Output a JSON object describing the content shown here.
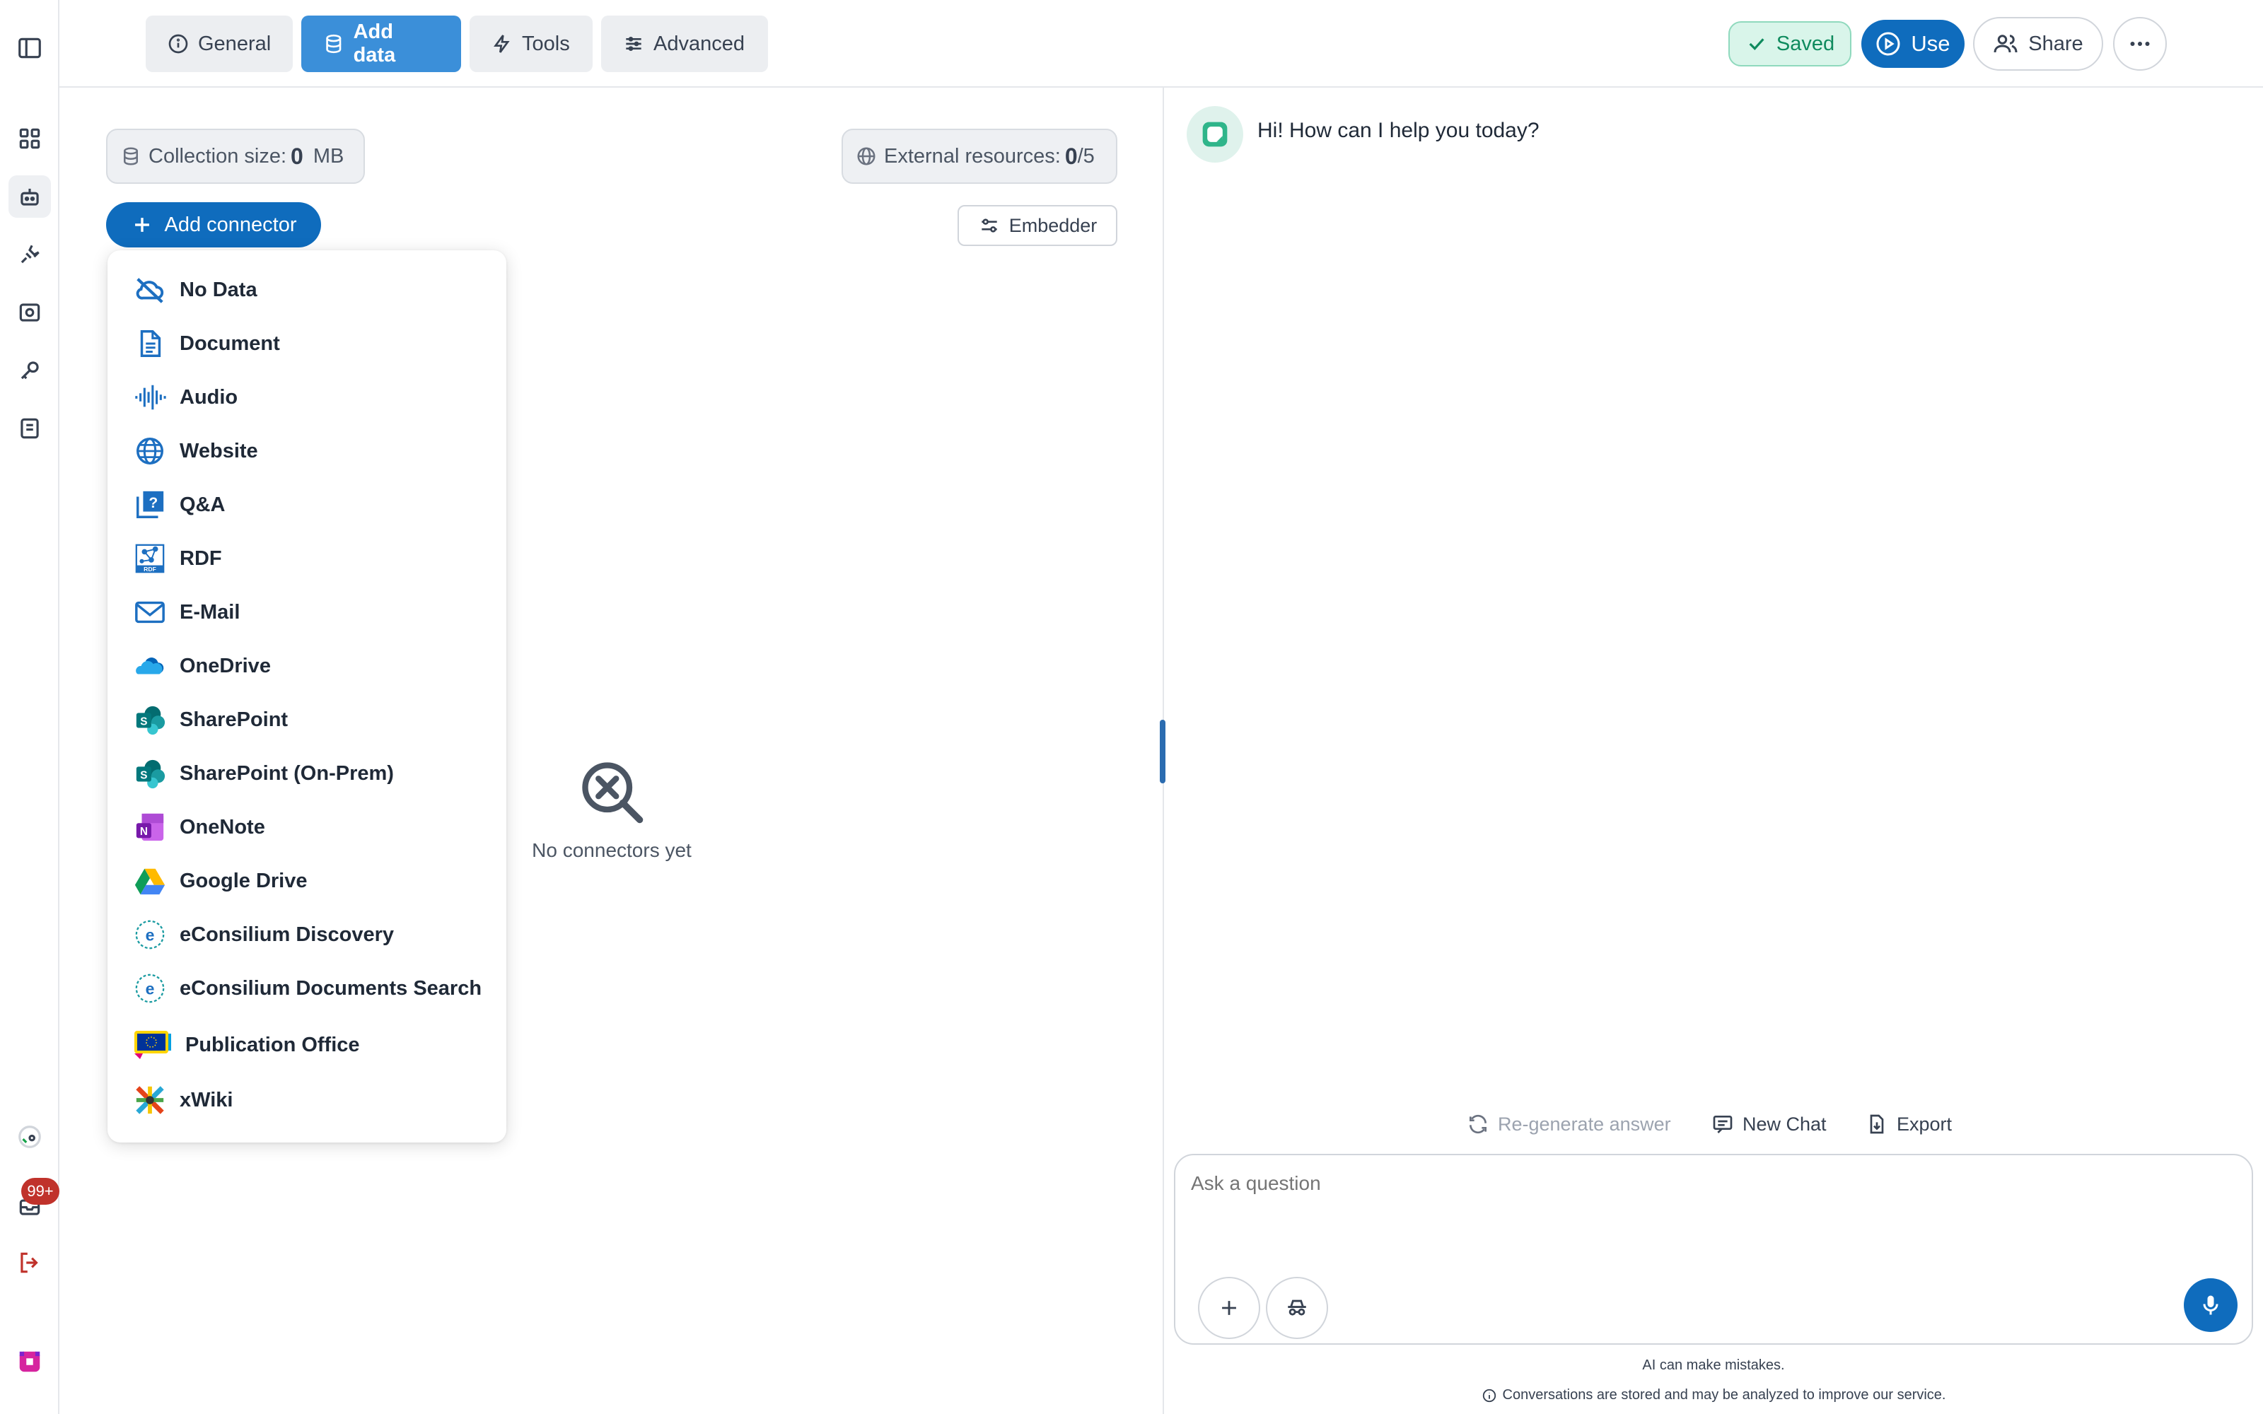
{
  "tabs": [
    {
      "label": "General",
      "icon": "info-icon",
      "active": false
    },
    {
      "label": "Add data",
      "icon": "database-icon",
      "active": true
    },
    {
      "label": "Tools",
      "icon": "lightning-icon",
      "active": false
    },
    {
      "label": "Advanced",
      "icon": "sliders-icon",
      "active": false
    }
  ],
  "header": {
    "saved_label": "Saved",
    "use_label": "Use",
    "share_label": "Share"
  },
  "rail": {
    "notification_count": "99+"
  },
  "left_panel": {
    "collection_label": "Collection size:",
    "collection_value": "0",
    "collection_unit": "MB",
    "external_label": "External resources:",
    "external_value": "0",
    "external_total": "/5",
    "add_connector_label": "Add connector",
    "embedder_label": "Embedder",
    "empty_text": "No connectors yet"
  },
  "connectors": [
    {
      "label": "No Data",
      "icon": "no-data-icon"
    },
    {
      "label": "Document",
      "icon": "document-icon"
    },
    {
      "label": "Audio",
      "icon": "audio-icon"
    },
    {
      "label": "Website",
      "icon": "globe-icon"
    },
    {
      "label": "Q&A",
      "icon": "qa-icon"
    },
    {
      "label": "RDF",
      "icon": "rdf-icon"
    },
    {
      "label": "E-Mail",
      "icon": "mail-icon"
    },
    {
      "label": "OneDrive",
      "icon": "onedrive-icon"
    },
    {
      "label": "SharePoint",
      "icon": "sharepoint-icon"
    },
    {
      "label": "SharePoint (On-Prem)",
      "icon": "sharepoint-icon"
    },
    {
      "label": "OneNote",
      "icon": "onenote-icon"
    },
    {
      "label": "Google Drive",
      "icon": "google-drive-icon"
    },
    {
      "label": "eConsilium Discovery",
      "icon": "econsilium-icon"
    },
    {
      "label": "eConsilium Documents Search",
      "icon": "econsilium-icon"
    },
    {
      "label": "Publication Office",
      "icon": "publication-office-icon"
    },
    {
      "label": "xWiki",
      "icon": "xwiki-icon"
    }
  ],
  "chat": {
    "greeting": "Hi! How can I help you today?",
    "regenerate_label": "Re-generate answer",
    "new_chat_label": "New Chat",
    "export_label": "Export",
    "input_placeholder": "Ask a question",
    "disclaimer_1": "AI can make mistakes.",
    "disclaimer_2": "Conversations are stored and may be analyzed to improve our service."
  },
  "colors": {
    "primary": "#0f6cbd",
    "active_tab": "#3b8fd9",
    "saved_green": "#0f8b5e",
    "badge_red": "#c0322b"
  }
}
